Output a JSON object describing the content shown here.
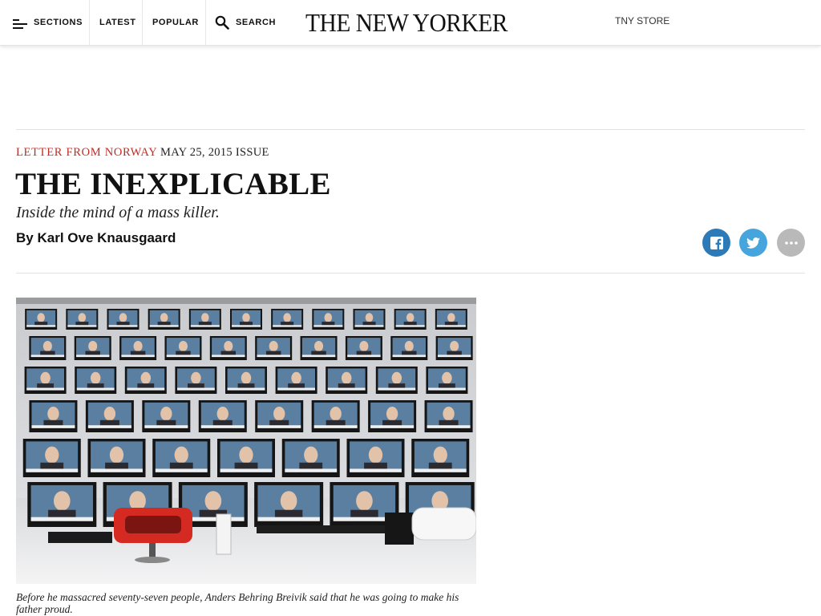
{
  "nav": {
    "sections_label": "SECTIONS",
    "latest_label": "LATEST",
    "popular_label": "POPULAR",
    "search_label": "SEARCH",
    "logo_text": "THE NEW YORKER",
    "store_label": "TNY STORE"
  },
  "article": {
    "rubric": "Letter from Norway",
    "issue": "May 25, 2015 Issue",
    "headline": "The Inexplicable",
    "dek": "Inside the mind of a mass killer.",
    "byline_prefix": "By ",
    "author": "Karl Ove Knausgaard"
  },
  "share": {
    "icons": [
      "facebook-icon",
      "twitter-icon",
      "more-icon"
    ]
  },
  "hero": {
    "caption": "Before he massacred seventy-seven people, Anders Behring Breivik said that he was going to make his father proud."
  },
  "colors": {
    "rubric_red": "#c22c27",
    "facebook_blue": "#2d7ab9",
    "twitter_blue": "#45a5dc",
    "more_gray": "#b9b9b9"
  }
}
